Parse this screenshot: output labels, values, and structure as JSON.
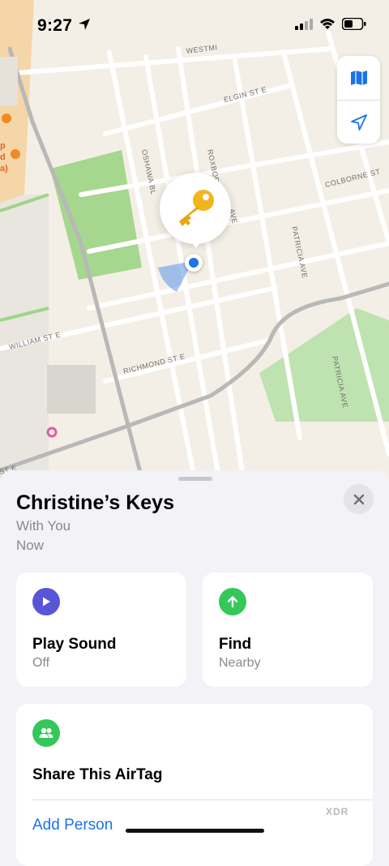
{
  "status_bar": {
    "time": "9:27"
  },
  "map": {
    "streets": [
      "WESTMI",
      "ELGIN ST E",
      "COLBORNE ST",
      "OSHAWA BL",
      "ROXBORO",
      "AVE",
      "PATRICIA AVE",
      "PATRICIA AVE",
      "WILLIAM ST E",
      "RICHMOND ST E",
      "ST E"
    ],
    "side_labels": [
      "p",
      "d",
      "a)"
    ],
    "controls": {
      "map_icon": "map-icon",
      "location_icon": "location-arrow-icon"
    },
    "pin_icon": "key-icon"
  },
  "sheet": {
    "title": "Christine’s Keys",
    "status": "With You",
    "time": "Now",
    "play_sound": {
      "label": "Play Sound",
      "value": "Off",
      "icon": "play-icon",
      "color": "#5856d6"
    },
    "find": {
      "label": "Find",
      "value": "Nearby",
      "icon": "arrow-up-icon",
      "color": "#34c759"
    },
    "share": {
      "label": "Share This AirTag",
      "icon": "people-icon",
      "color": "#34c759",
      "action": "Add Person"
    },
    "watermark": "XDR"
  }
}
